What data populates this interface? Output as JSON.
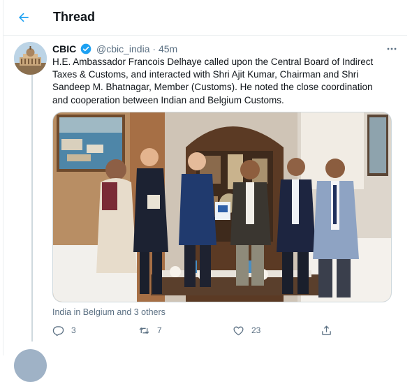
{
  "header": {
    "title": "Thread",
    "back_icon": "arrow-left-icon"
  },
  "tweet": {
    "author_name": "CBIC",
    "handle": "@cbic_india",
    "separator": "·",
    "time": "45m",
    "more_icon": "more-icon",
    "text": "H.E. Ambassador Francois Delhaye called upon the Central Board of Indirect Taxes & Customs, and interacted with Shri Ajit Kumar, Chairman and Shri Sandeep M. Bhatnagar, Member (Customs). He noted the close coordination and cooperation between Indian and Belgium Customs.",
    "tagged_location": "India in Belgium and 3 others",
    "replies": "3",
    "retweets": "7",
    "likes": "23"
  },
  "colors": {
    "accent": "#1da1f2",
    "secondary_text": "#5b7083",
    "border": "#ebeef0"
  }
}
